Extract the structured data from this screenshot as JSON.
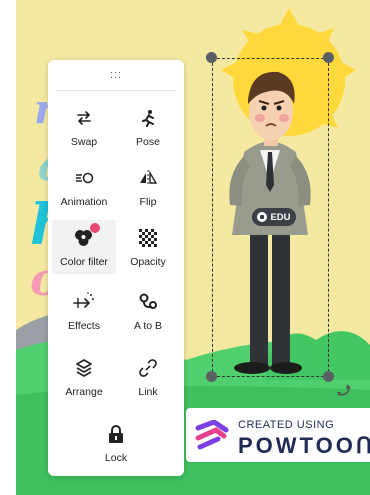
{
  "background_text": [
    "ri",
    "a",
    "he",
    "on"
  ],
  "toolbar": {
    "handle_glyph": ":::",
    "tools": [
      {
        "label": "Swap",
        "icon": "swap-icon"
      },
      {
        "label": "Pose",
        "icon": "pose-icon"
      },
      {
        "label": "Animation",
        "icon": "animation-icon"
      },
      {
        "label": "Flip",
        "icon": "flip-icon"
      },
      {
        "label": "Color filter",
        "icon": "color-filter-icon"
      },
      {
        "label": "Opacity",
        "icon": "opacity-icon"
      },
      {
        "label": "Effects",
        "icon": "effects-icon"
      },
      {
        "label": "A to B",
        "icon": "a-to-b-icon"
      },
      {
        "label": "Arrange",
        "icon": "arrange-icon"
      },
      {
        "label": "Link",
        "icon": "link-icon"
      },
      {
        "label": "Lock",
        "icon": "lock-icon"
      }
    ]
  },
  "selection": {
    "badge": "EDU"
  },
  "watermark": {
    "line1": "CREATED USING",
    "line2": "POWTOOՈ"
  },
  "colors": {
    "canvas_bg": "#f5e9a2",
    "grass": "#4fcf6e",
    "sun": "#ffd93b",
    "brand_navy": "#1f2a55",
    "brand_purple": "#7b3fe4"
  }
}
